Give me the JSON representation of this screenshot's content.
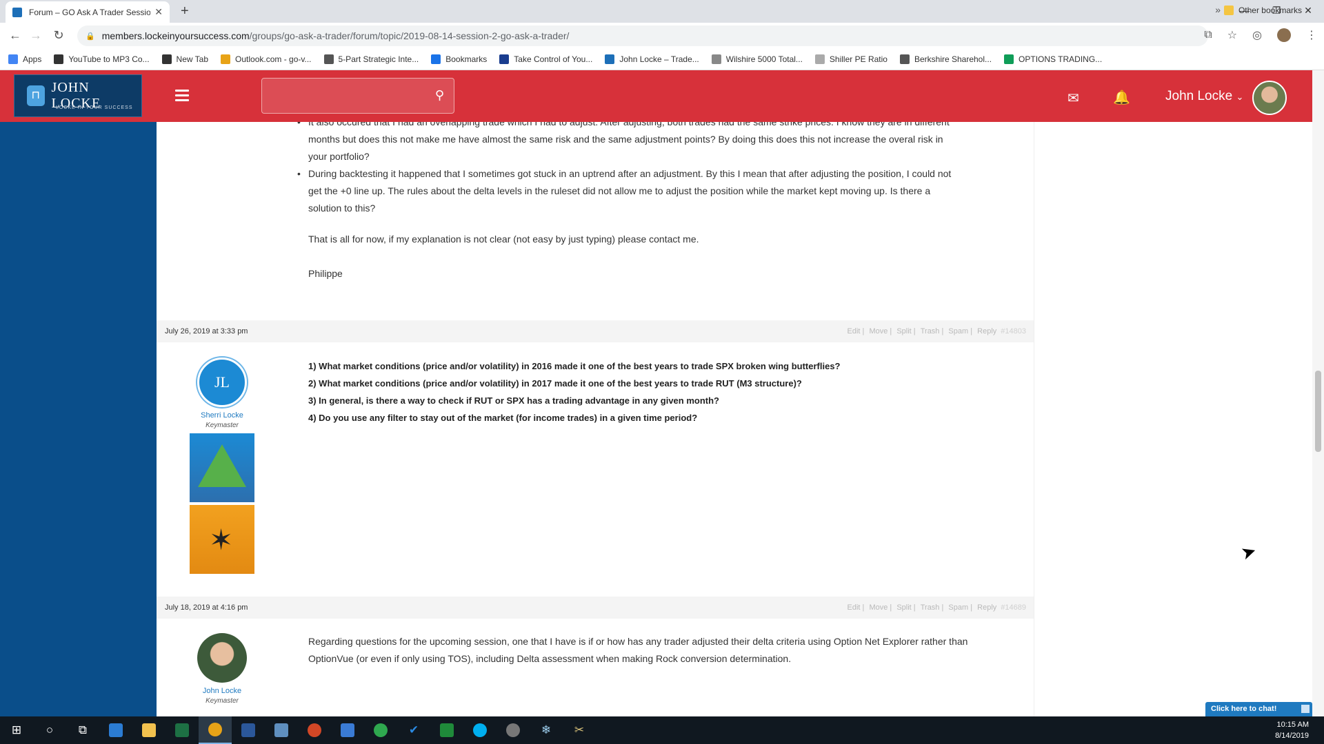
{
  "browser": {
    "tab_title": "Forum – GO Ask A Trader Session",
    "url_domain": "members.lockeinyoursuccess.com",
    "url_path": "/groups/go-ask-a-trader/forum/topic/2019-08-14-session-2-go-ask-a-trader/",
    "bookmarks": [
      {
        "label": "Apps",
        "color": "#4285f4"
      },
      {
        "label": "YouTube to MP3 Co...",
        "color": "#333333"
      },
      {
        "label": "New Tab",
        "color": "#333333"
      },
      {
        "label": "Outlook.com - go-v...",
        "color": "#e8a317"
      },
      {
        "label": "5-Part Strategic Inte...",
        "color": "#555555"
      },
      {
        "label": "Bookmarks",
        "color": "#1a73e8"
      },
      {
        "label": "Take Control of You...",
        "color": "#1a3d8f"
      },
      {
        "label": "John Locke – Trade...",
        "color": "#1d6fb8"
      },
      {
        "label": "Wilshire 5000 Total...",
        "color": "#888888"
      },
      {
        "label": "Shiller PE Ratio",
        "color": "#aaaaaa"
      },
      {
        "label": "Berkshire Sharehol...",
        "color": "#555555"
      },
      {
        "label": "OPTIONS TRADING...",
        "color": "#0f9d58"
      }
    ],
    "other_bookmarks": "Other bookmarks"
  },
  "site": {
    "logo_name": "JOHN LOCKE",
    "logo_tagline": "LOCKE IN YOUR SUCCESS",
    "user_name": "John Locke",
    "brand_color": "#d7313a",
    "sidebar_color": "#0a4e8a"
  },
  "post1": {
    "bullets": [
      "It also occured that I had an overlapping trade which I had to adjust. After adjusting, both trades had the same strike prices. I know they are in different months but does this not make me have almost the same risk and the same adjustment points? By doing this does this not increase the overal risk in your portfolio?",
      "During backtesting it happened that I sometimes got stuck in an uptrend after an adjustment. By this I mean that after adjusting the position, I could not get the +0 line up. The rules about the delta levels in the ruleset did not allow me to adjust the position while the market kept moving up. Is there a solution to this?"
    ],
    "closing": "That is all for now, if my explanation is not clear (not easy by just typing) please contact me.",
    "signoff": "Philippe"
  },
  "actions": {
    "edit": "Edit",
    "move": "Move",
    "split": "Split",
    "trash": "Trash",
    "spam": "Spam",
    "reply": "Reply"
  },
  "post2": {
    "date": "July 26, 2019 at 3:33 pm",
    "post_id": "#14803",
    "author_name": "Sherri Locke",
    "author_initials": "JL",
    "author_role": "Keymaster",
    "questions": [
      "1) What market conditions (price and/or volatility) in 2016 made it one of the best years to trade SPX broken wing butterflies?",
      "2) What market conditions (price and/or volatility) in 2017 made it one of the best years to trade RUT (M3 structure)?",
      "3) In general, is there a way to check if RUT or SPX has a trading advantage in any given month?",
      "4) Do you use any filter to stay out of the market (for income trades) in a given time period?"
    ]
  },
  "post3": {
    "date": "July 18, 2019 at 4:16 pm",
    "post_id": "#14689",
    "author_name": "John Locke",
    "author_role": "Keymaster",
    "text": "Regarding questions for the upcoming session, one that I have is if or how has any trader adjusted their delta criteria using Option Net Explorer rather than OptionVue (or even if only using TOS), including Delta assessment when making Rock conversion determination."
  },
  "chat": {
    "label": "Click here to chat!"
  },
  "taskbar": {
    "time": "10:15 AM",
    "date": "8/14/2019"
  }
}
